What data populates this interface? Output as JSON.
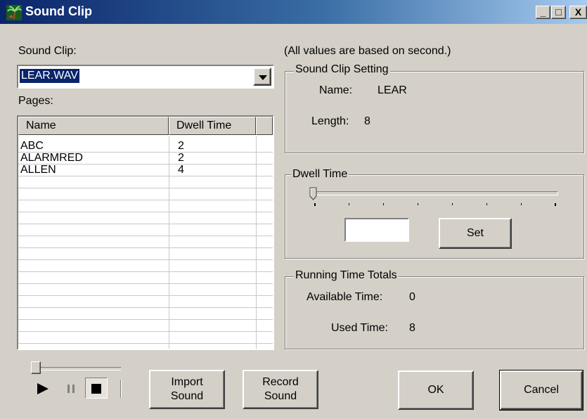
{
  "window": {
    "title": "Sound Clip",
    "minimize": "_",
    "maximize": "□",
    "close": "X"
  },
  "left": {
    "sound_clip_label": "Sound Clip:",
    "sound_clip_value": "LEAR.WAV",
    "pages_label": "Pages:",
    "columns": [
      "Name",
      "Dwell Time"
    ],
    "rows": [
      {
        "name": "ABC",
        "dwell": "2"
      },
      {
        "name": "ALARMRED",
        "dwell": "2"
      },
      {
        "name": "ALLEN",
        "dwell": "4"
      }
    ]
  },
  "right": {
    "note": "(All values are based on second.)",
    "setting": {
      "title": "Sound Clip Setting",
      "name_label": "Name:",
      "name_value": "LEAR",
      "length_label": "Length:",
      "length_value": "8"
    },
    "dwell": {
      "title": "Dwell Time",
      "input_value": "",
      "set_label": "Set",
      "slider_position": 0
    },
    "totals": {
      "title": "Running Time Totals",
      "available_label": "Available Time:",
      "available_value": "0",
      "used_label": "Used Time:",
      "used_value": "8"
    }
  },
  "player": {
    "progress": 0
  },
  "buttons": {
    "import_line1": "Import",
    "import_line2": "Sound",
    "record_line1": "Record",
    "record_line2": "Sound",
    "ok": "OK",
    "cancel": "Cancel"
  },
  "icons": [
    "palm-tree-icon",
    "play-icon",
    "pause-icon",
    "stop-icon"
  ]
}
